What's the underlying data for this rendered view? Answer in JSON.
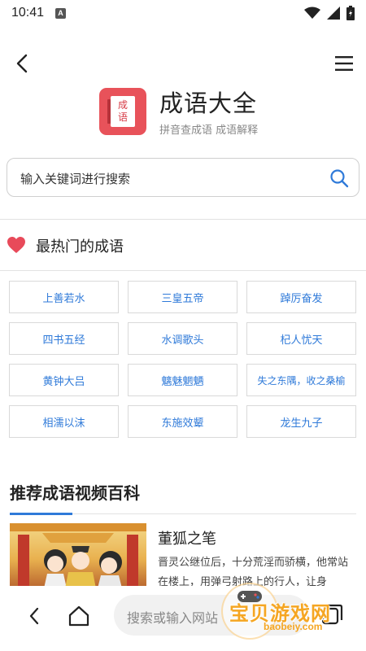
{
  "status_bar": {
    "time": "10:41",
    "notification_icon": "A"
  },
  "header": {
    "back_icon": "chevron-left",
    "menu_icon": "hamburger-menu"
  },
  "app": {
    "logo_text_top": "成",
    "logo_text_bottom": "语",
    "title": "成语大全",
    "subtitle": "拼音查成语 成语解释"
  },
  "search": {
    "placeholder": "输入关键词进行搜索"
  },
  "hot_section": {
    "title": "最热门的成语",
    "idioms": [
      "上善若水",
      "三皇五帝",
      "踔厉奋发",
      "四书五经",
      "水调歌头",
      "杞人忧天",
      "黄钟大吕",
      "魑魅魍魉",
      "失之东隅，收之桑榆",
      "相濡以沫",
      "东施效颦",
      "龙生九子"
    ]
  },
  "video_section": {
    "title": "推荐成语视频百科",
    "item": {
      "name": "董狐之笔",
      "desc": "晋灵公继位后，十分荒淫而骄横，他常站在楼上，用弹弓射路上的行人，让身"
    }
  },
  "bottom_nav": {
    "url_placeholder": "搜索或输入网站"
  },
  "watermark": {
    "text": "宝贝游戏网",
    "url": "baobeiy.com"
  },
  "colors": {
    "accent": "#2f7ad9",
    "logo": "#e8525a",
    "heart": "#e84a5a",
    "watermark": "#f5a623"
  }
}
